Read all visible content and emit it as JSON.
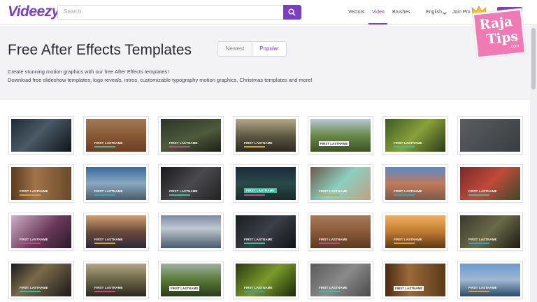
{
  "header": {
    "logo": "Videezy",
    "search_placeholder": "Search",
    "nav": {
      "vectors": "Vectors",
      "video": "Video",
      "brushes": "Brushes",
      "language": "English",
      "join_pro": "Join Pro",
      "signup": "Sign up"
    }
  },
  "hero": {
    "title": "Free After Effects Templates",
    "sort": {
      "newest": "Newest",
      "popular": "Popular"
    },
    "desc_line1": "Create stunning motion graphics with our free After Effects templates!",
    "desc_line2": "Download free slideshow templates, logo reveals, intros, customizable typography motion graphics, Christmas templates and more!"
  },
  "watermark": {
    "line1": "Raja",
    "line2": "Tips",
    "line3": ".com"
  },
  "colors": {
    "accent": "#7b3fc4",
    "hero_bg": "#f3f3f5"
  },
  "thumbnails": [
    {
      "caption": "",
      "style": "A"
    },
    {
      "caption": "FIRST LASTNAME",
      "style": "A"
    },
    {
      "caption": "FIRST LASTNAME",
      "style": "A"
    },
    {
      "caption": "FIRST LASTNAME",
      "style": "A"
    },
    {
      "caption": "FIRST LASTNAME",
      "style": "B"
    },
    {
      "caption": "FIRST LASTNAME",
      "style": "A"
    },
    {
      "caption": "",
      "style": "A"
    },
    {
      "caption": "FIRST LASTNAME",
      "style": "A"
    },
    {
      "caption": "FIRST LASTNAME",
      "style": "A"
    },
    {
      "caption": "FIRST LASTNAME",
      "style": "A"
    },
    {
      "caption": "FIRST LASTNAME",
      "style": "C"
    },
    {
      "caption": "FIRST LASTNAME",
      "style": "A"
    },
    {
      "caption": "FIRST LASTNAME",
      "style": "A"
    },
    {
      "caption": "FIRST LASTNAME",
      "style": "A"
    },
    {
      "caption": "FIRST LASTNAME",
      "style": "A"
    },
    {
      "caption": "FIRST LASTNAME",
      "style": "A"
    },
    {
      "caption": "",
      "style": "A"
    },
    {
      "caption": "FIRST LASTNAME",
      "style": "A"
    },
    {
      "caption": "FIRST LASTNAME",
      "style": "A"
    },
    {
      "caption": "FIRST LASTNAME",
      "style": "A"
    },
    {
      "caption": "FIRST LASTNAME",
      "style": "A"
    },
    {
      "caption": "FIRST LASTNAME",
      "style": "A"
    },
    {
      "caption": "FIRST LASTNAME",
      "style": "A"
    },
    {
      "caption": "FIRST LASTNAME",
      "style": "B"
    },
    {
      "caption": "FIRST LASTNAME",
      "style": "A"
    },
    {
      "caption": "FIRST LASTNAME",
      "style": "A"
    },
    {
      "caption": "FIRST LASTNAME",
      "style": "B"
    },
    {
      "caption": "FIRST LASTNAME",
      "style": "A"
    }
  ]
}
